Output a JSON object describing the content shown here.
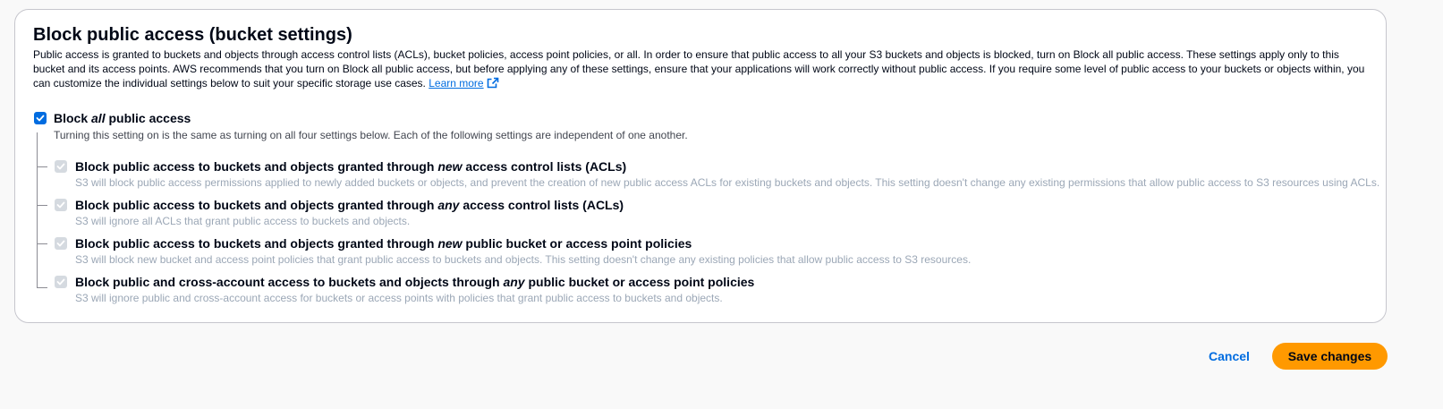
{
  "panel": {
    "title": "Block public access (bucket settings)",
    "description": "Public access is granted to buckets and objects through access control lists (ACLs), bucket policies, access point policies, or all. In order to ensure that public access to all your S3 buckets and objects is blocked, turn on Block all public access. These settings apply only to this bucket and its access points. AWS recommends that you turn on Block all public access, but before applying any of these settings, ensure that your applications will work correctly without public access. If you require some level of public access to your buckets or objects within, you can customize the individual settings below to suit your specific storage use cases.",
    "learn_more": "Learn more",
    "learn_more_icon": "external-link-icon"
  },
  "block_all": {
    "label_before": "Block ",
    "label_emphasis": "all",
    "label_after": " public access",
    "checked": true,
    "description": "Turning this setting on is the same as turning on all four settings below. Each of the following settings are independent of one another."
  },
  "settings": [
    {
      "label_before": "Block public access to buckets and objects granted through ",
      "label_emphasis": "new",
      "label_after": " access control lists (ACLs)",
      "description": "S3 will block public access permissions applied to newly added buckets or objects, and prevent the creation of new public access ACLs for existing buckets and objects. This setting doesn't change any existing permissions that allow public access to S3 resources using ACLs.",
      "checked": true,
      "disabled": true
    },
    {
      "label_before": "Block public access to buckets and objects granted through ",
      "label_emphasis": "any",
      "label_after": " access control lists (ACLs)",
      "description": "S3 will ignore all ACLs that grant public access to buckets and objects.",
      "checked": true,
      "disabled": true
    },
    {
      "label_before": "Block public access to buckets and objects granted through ",
      "label_emphasis": "new",
      "label_after": " public bucket or access point policies",
      "description": "S3 will block new bucket and access point policies that grant public access to buckets and objects. This setting doesn't change any existing policies that allow public access to S3 resources.",
      "checked": true,
      "disabled": true
    },
    {
      "label_before": "Block public and cross-account access to buckets and objects through ",
      "label_emphasis": "any",
      "label_after": " public bucket or access point policies",
      "description": "S3 will ignore public and cross-account access for buckets or access points with policies that grant public access to buckets and objects.",
      "checked": true,
      "disabled": true
    }
  ],
  "actions": {
    "cancel_label": "Cancel",
    "save_label": "Save changes"
  },
  "colors": {
    "accent": "#006ce0",
    "primary_button": "#ff9900",
    "disabled_check": "#d5dae0",
    "disabled_text": "#9ba7b6"
  }
}
